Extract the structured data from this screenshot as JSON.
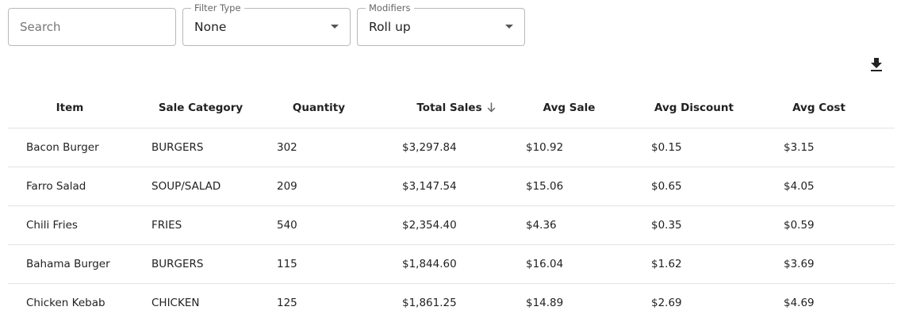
{
  "filters": {
    "search_placeholder": "Search",
    "filter_type": {
      "label": "Filter Type",
      "value": "None"
    },
    "modifiers": {
      "label": "Modifiers",
      "value": "Roll up"
    }
  },
  "toolbar": {
    "download_icon": "download-icon"
  },
  "table": {
    "columns": [
      "Item",
      "Sale Category",
      "Quantity",
      "Total Sales",
      "Avg Sale",
      "Avg Discount",
      "Avg Cost"
    ],
    "sort": {
      "column": "Total Sales",
      "direction": "descending",
      "icon": "arrow-down-icon"
    },
    "rows": [
      [
        "Bacon Burger",
        "BURGERS",
        "302",
        "$3,297.84",
        "$10.92",
        "$0.15",
        "$3.15"
      ],
      [
        "Farro Salad",
        "SOUP/SALAD",
        "209",
        "$3,147.54",
        "$15.06",
        "$0.65",
        "$4.05"
      ],
      [
        "Chili Fries",
        "FRIES",
        "540",
        "$2,354.40",
        "$4.36",
        "$0.35",
        "$0.59"
      ],
      [
        "Bahama Burger",
        "BURGERS",
        "115",
        "$1,844.60",
        "$16.04",
        "$1.62",
        "$3.69"
      ],
      [
        "Chicken Kebab",
        "CHICKEN",
        "125",
        "$1,861.25",
        "$14.89",
        "$2.69",
        "$4.69"
      ]
    ]
  }
}
